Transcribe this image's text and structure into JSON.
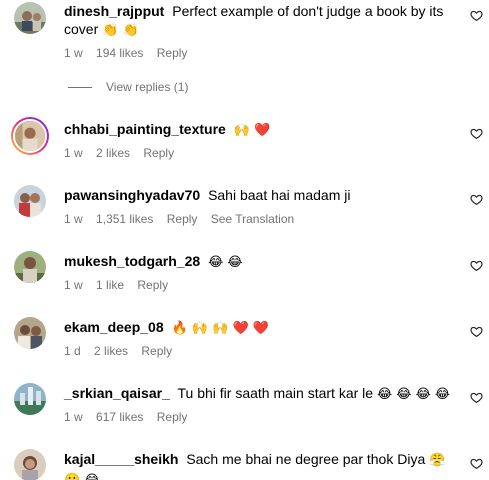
{
  "comments": [
    {
      "username": "dinesh_rajpput",
      "text": "Perfect example of don't judge a book by its cover",
      "emojis": "👏 👏",
      "time": "1 w",
      "likes": "194 likes",
      "reply": "Reply",
      "view_replies": "View replies (1)"
    },
    {
      "username": "chhabi_painting_texture",
      "text": "",
      "emojis": "🙌 ❤️",
      "time": "1 w",
      "likes": "2 likes",
      "reply": "Reply"
    },
    {
      "username": "pawansinghyadav70",
      "text": "Sahi baat hai madam ji",
      "emojis": "",
      "time": "1 w",
      "likes": "1,351 likes",
      "reply": "Reply",
      "translation": "See Translation"
    },
    {
      "username": "mukesh_todgarh_28",
      "text": "",
      "emojis": "😂 😂",
      "time": "1 w",
      "likes": "1 like",
      "reply": "Reply"
    },
    {
      "username": "ekam_deep_08",
      "text": "",
      "emojis": "🔥 🙌 🙌 ❤️ ❤️",
      "time": "1 d",
      "likes": "2 likes",
      "reply": "Reply"
    },
    {
      "username": "_srkian_qaisar_",
      "text": "Tu bhi fir saath main start kar le",
      "emojis": "😂 😂 😂 😂",
      "time": "1 w",
      "likes": "617 likes",
      "reply": "Reply"
    },
    {
      "username": "kajal_____sheikh",
      "text": "Sach me bhai ne degree par thok Diya",
      "emojis": "😤 🙂 😂",
      "time": "",
      "likes": "",
      "reply": ""
    }
  ],
  "icons": {
    "like": "heart-outline-icon"
  },
  "colors": {
    "text": "#000000",
    "meta": "#737373",
    "ring_gradient": [
      "#f9ce34",
      "#ee2a7b",
      "#6228d7"
    ]
  }
}
